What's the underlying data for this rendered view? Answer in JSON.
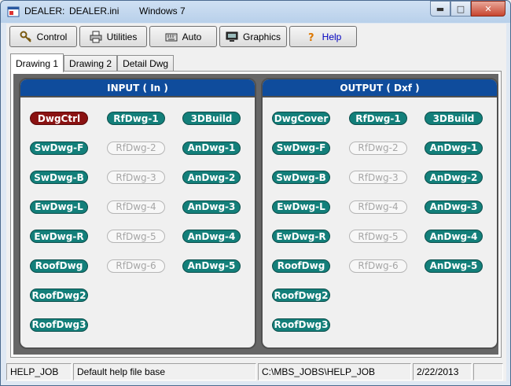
{
  "window": {
    "app_name": "DEALER:",
    "file_name": "DEALER.ini",
    "os_label": "Windows 7"
  },
  "toolbar": {
    "buttons": [
      {
        "label": "Control",
        "icon": "key-icon"
      },
      {
        "label": "Utilities",
        "icon": "printer-icon"
      },
      {
        "label": "Auto",
        "icon": "keyboard-icon"
      },
      {
        "label": "Graphics",
        "icon": "monitor-icon"
      },
      {
        "label": "Help",
        "icon": "question-icon"
      }
    ]
  },
  "tabs": [
    "Drawing 1",
    "Drawing 2",
    "Detail Dwg"
  ],
  "active_tab": "Drawing 1",
  "input": {
    "title": "INPUT ( In )",
    "col1": [
      "DwgCtrl",
      "SwDwg-F",
      "SwDwg-B",
      "EwDwg-L",
      "EwDwg-R",
      "RoofDwg",
      "RoofDwg2",
      "RoofDwg3"
    ],
    "col2": [
      "RfDwg-1",
      "RfDwg-2",
      "RfDwg-3",
      "RfDwg-4",
      "RfDwg-5",
      "RfDwg-6"
    ],
    "col3": [
      "3DBuild",
      "AnDwg-1",
      "AnDwg-2",
      "AnDwg-3",
      "AnDwg-4",
      "AnDwg-5"
    ]
  },
  "output": {
    "title": "OUTPUT ( Dxf )",
    "col1": [
      "DwgCover",
      "SwDwg-F",
      "SwDwg-B",
      "EwDwg-L",
      "EwDwg-R",
      "RoofDwg",
      "RoofDwg2",
      "RoofDwg3"
    ],
    "col2": [
      "RfDwg-1",
      "RfDwg-2",
      "RfDwg-3",
      "RfDwg-4",
      "RfDwg-5",
      "RfDwg-6"
    ],
    "col3": [
      "3DBuild",
      "AnDwg-1",
      "AnDwg-2",
      "AnDwg-3",
      "AnDwg-4",
      "AnDwg-5"
    ]
  },
  "status": {
    "job": "HELP_JOB",
    "message": "Default help file base",
    "path": "C:\\MBS_JOBS\\HELP_JOB",
    "date": "2/22/2013"
  },
  "colors": {
    "header_blue": "#0f4c9c",
    "pill_teal": "#137f7a",
    "pill_red": "#8a1212",
    "pill_disabled_text": "#a6a6a6"
  }
}
